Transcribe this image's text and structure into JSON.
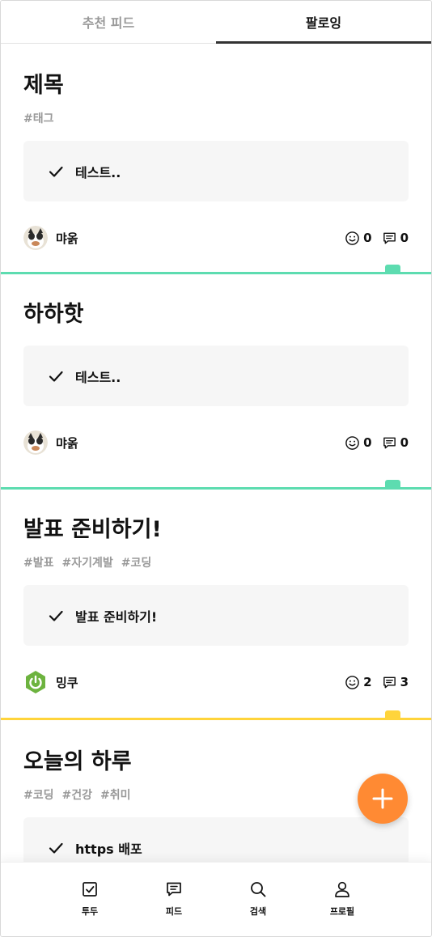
{
  "tabs": [
    {
      "label": "추천 피드",
      "active": false
    },
    {
      "label": "팔로잉",
      "active": true
    }
  ],
  "posts": [
    {
      "title": "제목",
      "tags": [
        "#태그"
      ],
      "todo": "테스트..",
      "author": "먀옭",
      "reactions": "0",
      "comments": "0",
      "accent": "#5ddcb0"
    },
    {
      "title": "하하핫",
      "tags": [],
      "todo": "테스트..",
      "author": "먀옭",
      "reactions": "0",
      "comments": "0",
      "accent": "#5ddcb0"
    },
    {
      "title": "발표 준비하기!",
      "tags": [
        "#발표",
        "#자기계발",
        "#코딩"
      ],
      "todo": "발표 준비하기!",
      "author": "밍쿠",
      "reactions": "2",
      "comments": "3",
      "accent": "#ffd43b"
    },
    {
      "title": "오늘의 하루",
      "tags": [
        "#코딩",
        "#건강",
        "#취미"
      ],
      "todo": "https 배포",
      "author": "",
      "reactions": "",
      "comments": "",
      "accent": ""
    }
  ],
  "fab": {
    "icon": "plus-icon",
    "color": "#ff8a33"
  },
  "nav": [
    {
      "label": "투두",
      "icon": "checkbox-icon"
    },
    {
      "label": "피드",
      "icon": "chat-icon"
    },
    {
      "label": "검색",
      "icon": "search-icon"
    },
    {
      "label": "프로필",
      "icon": "user-icon"
    }
  ]
}
